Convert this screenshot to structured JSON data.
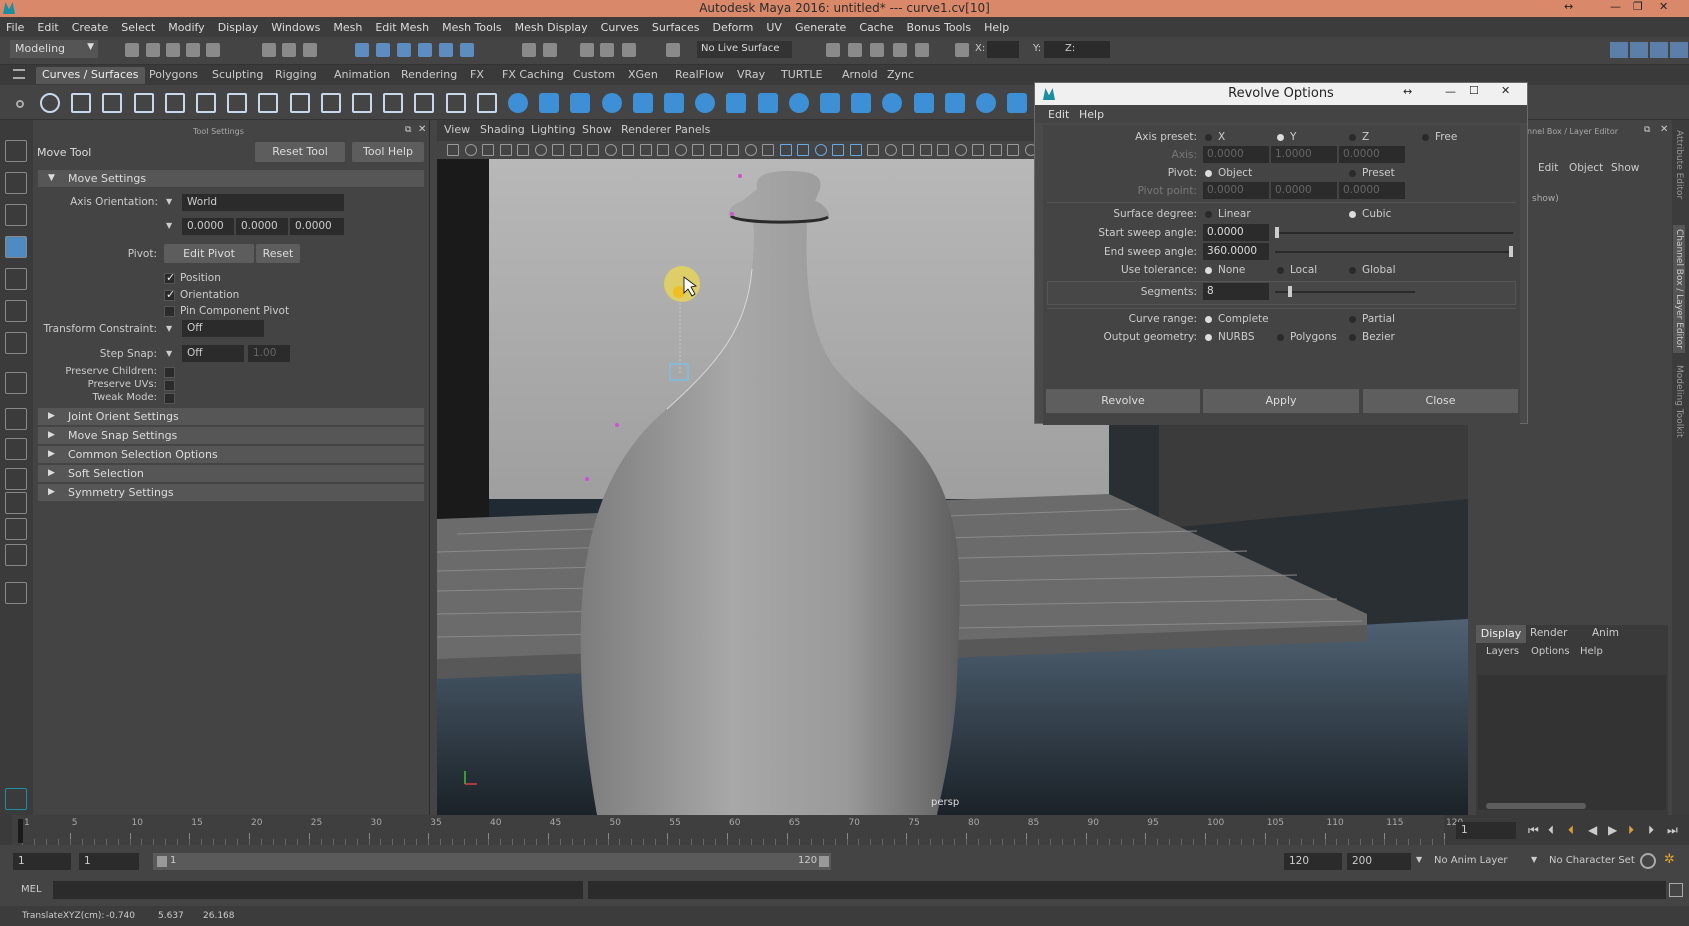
{
  "title_bar": {
    "title": "Autodesk Maya 2016: untitled*   ---   curve1.cv[10]"
  },
  "menu": [
    "File",
    "Edit",
    "Create",
    "Select",
    "Modify",
    "Display",
    "Windows",
    "Mesh",
    "Edit Mesh",
    "Mesh Tools",
    "Mesh Display",
    "Curves",
    "Surfaces",
    "Deform",
    "UV",
    "Generate",
    "Cache",
    "Bonus Tools",
    "Help"
  ],
  "status_line": {
    "mode": "Modeling",
    "live_surface": "No Live Surface",
    "x_label": "X:",
    "y_label": "Y:",
    "z_label": "Z:"
  },
  "shelf_tabs": [
    "Curves / Surfaces",
    "Polygons",
    "Sculpting",
    "Rigging",
    "Animation",
    "Rendering",
    "FX",
    "FX Caching",
    "Custom",
    "XGen",
    "RealFlow",
    "VRay",
    "TURTLE",
    "Arnold",
    "Zync"
  ],
  "tool_settings": {
    "header": "Tool Settings",
    "tool_name": "Move Tool",
    "reset_tool": "Reset Tool",
    "tool_help": "Tool Help",
    "move_settings": "Move Settings",
    "axis_orientation_label": "Axis Orientation:",
    "axis_orientation_value": "World",
    "vec_x": "0.0000",
    "vec_y": "0.0000",
    "vec_z": "0.0000",
    "pivot_label": "Pivot:",
    "edit_pivot": "Edit Pivot",
    "reset": "Reset",
    "position": "Position",
    "orientation": "Orientation",
    "pin_component_pivot": "Pin Component Pivot",
    "transform_constraint_label": "Transform Constraint:",
    "transform_constraint_value": "Off",
    "step_snap_label": "Step Snap:",
    "step_snap_value": "Off",
    "step_snap_amount": "1.00",
    "preserve_children": "Preserve Children:",
    "preserve_uvs": "Preserve UVs:",
    "tweak_mode": "Tweak Mode:",
    "sections": [
      "Joint Orient Settings",
      "Move Snap Settings",
      "Common Selection Options",
      "Soft Selection",
      "Symmetry Settings"
    ]
  },
  "viewport": {
    "menu": [
      "View",
      "Shading",
      "Lighting",
      "Show",
      "Renderer",
      "Panels"
    ],
    "camera_label": "persp"
  },
  "revolve_options": {
    "title": "Revolve Options",
    "menu": [
      "Edit",
      "Help"
    ],
    "axis_preset_label": "Axis preset:",
    "axis_preset_options": [
      "X",
      "Y",
      "Z",
      "Free"
    ],
    "axis_label": "Axis:",
    "axis_values": [
      "0.0000",
      "1.0000",
      "0.0000"
    ],
    "pivot_label": "Pivot:",
    "pivot_options": [
      "Object",
      "Preset"
    ],
    "pivot_point_label": "Pivot point:",
    "pivot_point_values": [
      "0.0000",
      "0.0000",
      "0.0000"
    ],
    "surface_degree_label": "Surface degree:",
    "surface_degree_options": [
      "Linear",
      "Cubic"
    ],
    "start_sweep_label": "Start sweep angle:",
    "start_sweep_value": "0.0000",
    "end_sweep_label": "End sweep angle:",
    "end_sweep_value": "360.0000",
    "use_tolerance_label": "Use tolerance:",
    "use_tolerance_options": [
      "None",
      "Local",
      "Global"
    ],
    "segments_label": "Segments:",
    "segments_value": "8",
    "curve_range_label": "Curve range:",
    "curve_range_options": [
      "Complete",
      "Partial"
    ],
    "output_geometry_label": "Output geometry:",
    "output_geometry_options": [
      "NURBS",
      "Polygons",
      "Bezier"
    ],
    "buttons": [
      "Revolve",
      "Apply",
      "Close"
    ]
  },
  "channel_box": {
    "title": "nnel Box / Layer Editor",
    "menu": [
      "Edit",
      "Object",
      "Show"
    ],
    "hint": "show)",
    "layer_tabs": [
      "Display",
      "Render",
      "Anim"
    ],
    "layer_menu": [
      "Layers",
      "Options",
      "Help"
    ]
  },
  "side_tabs": [
    "Attribute Editor",
    "Channel Box / Layer Editor",
    "Modeling Toolkit"
  ],
  "timeline": {
    "ticks": [
      "1",
      "5",
      "10",
      "15",
      "20",
      "25",
      "30",
      "35",
      "40",
      "45",
      "50",
      "55",
      "60",
      "65",
      "70",
      "75",
      "80",
      "85",
      "90",
      "95",
      "100",
      "105",
      "110",
      "115",
      "120"
    ],
    "current_frame": "1"
  },
  "range": {
    "start": "1",
    "playback_start": "1",
    "slider_start": "1",
    "slider_end": "120",
    "playback_end": "120",
    "end": "200",
    "anim_layer": "No Anim Layer",
    "character_set": "No Character Set"
  },
  "command_line": {
    "label": "MEL"
  },
  "help_line": {
    "label": "TranslateXYZ(cm):",
    "x": "-0.740",
    "y": "5.637",
    "z": "26.168"
  }
}
